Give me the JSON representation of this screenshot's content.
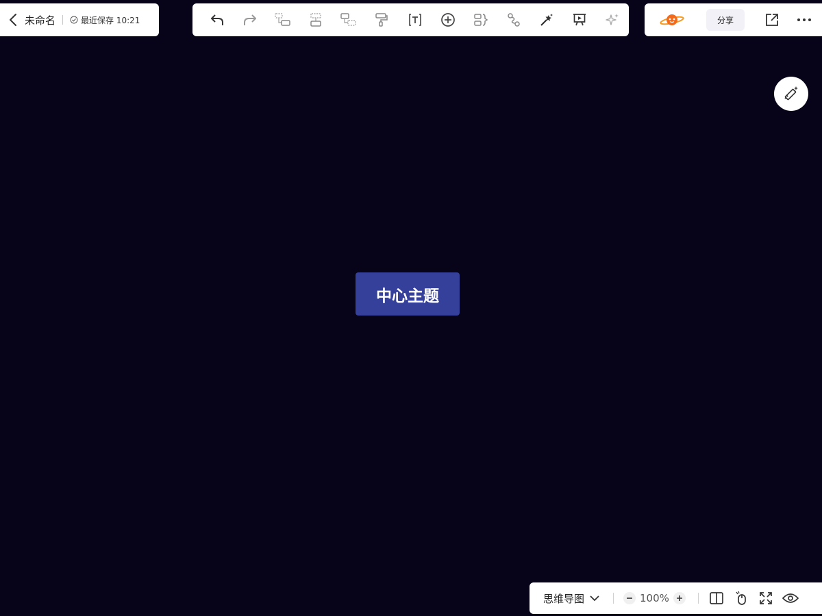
{
  "header": {
    "title": "未命名",
    "save_status": "最近保存 10:21"
  },
  "toolbar": {
    "items": [
      {
        "name": "undo-icon"
      },
      {
        "name": "redo-icon"
      },
      {
        "name": "add-child-topic-icon"
      },
      {
        "name": "add-sibling-topic-icon"
      },
      {
        "name": "add-parent-topic-icon"
      },
      {
        "name": "format-painter-icon"
      },
      {
        "name": "text-icon"
      },
      {
        "name": "insert-plus-icon"
      },
      {
        "name": "summary-icon"
      },
      {
        "name": "relation-line-icon"
      },
      {
        "name": "style-magic-icon"
      },
      {
        "name": "presentation-icon"
      },
      {
        "name": "ai-sparkle-icon"
      }
    ]
  },
  "right_header": {
    "share_label": "分享"
  },
  "canvas": {
    "center_topic": "中心主题",
    "background": "#070419",
    "node_color": "#34409a"
  },
  "bottom_bar": {
    "mode_label": "思维导图",
    "zoom": "100%"
  }
}
